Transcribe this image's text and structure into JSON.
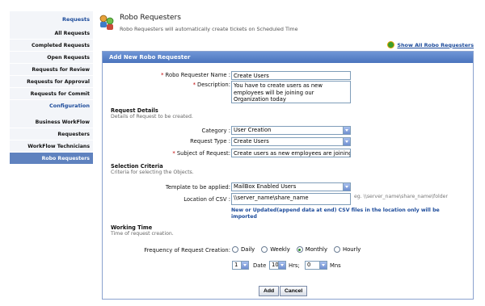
{
  "sidebar": {
    "section_requests": "Requests",
    "section_configuration": "Configuration",
    "requests_items": [
      {
        "label": "All Requests"
      },
      {
        "label": "Completed Requests"
      },
      {
        "label": "Open Requests"
      },
      {
        "label": "Requests for Review"
      },
      {
        "label": "Requests for Approval"
      },
      {
        "label": "Requests for Commit"
      }
    ],
    "config_items": [
      {
        "label": "Business WorkFlow"
      },
      {
        "label": "Requesters"
      },
      {
        "label": "WorkFlow Technicians"
      },
      {
        "label": "Robo Requesters"
      }
    ]
  },
  "header": {
    "title": "Robo Requesters",
    "subtitle": "Robo Requesters will automatically create tickets on Scheduled Time",
    "show_all": "Show All Robo Requesters"
  },
  "panel": {
    "title": "Add New Robo Requester"
  },
  "form": {
    "name_label": "Robo Requester Name :",
    "name_value": "Create Users",
    "description_label": "Description:",
    "description_value": "You have to create users as new employees will be joining our Organization today",
    "request_details_title": "Request Details",
    "request_details_desc": "Details of Request to be created.",
    "category_label": "Category :",
    "category_value": "User Creation",
    "request_type_label": "Request Type :",
    "request_type_value": "Create Users",
    "subject_label": "Subject of Request:",
    "subject_value": "Create users as new employees are joining",
    "selection_title": "Selection Criteria",
    "selection_desc": "Criteria for selecting the Objects.",
    "template_label": "Template to be applied:",
    "template_value": "MailBox Enabled Users",
    "csv_label": "Location of CSV :",
    "csv_value": "\\\\server_name\\share_name",
    "csv_hint": "eg. \\\\server_name\\share_name\\folder",
    "csv_note": "New or Updated(append data at end) CSV files in the location only will be imported",
    "working_title": "Working Time",
    "working_desc": "Time of request creation.",
    "frequency_label": "Frequency of Request Creation:",
    "frequency_options": [
      "Daily",
      "Weekly",
      "Monthly",
      "Hourly"
    ],
    "frequency_selected": "Monthly",
    "day_value": "1",
    "date_label": "Date",
    "hrs_value": "10",
    "hrs_label": "Hrs;",
    "mins_value": "0",
    "mins_label": "Mns",
    "add_button": "Add",
    "cancel_button": "Cancel"
  },
  "colors": {
    "accent": "#5f82bf",
    "header_bar": "#4a74bd",
    "link": "#1b4a9a",
    "required": "#c00000"
  }
}
